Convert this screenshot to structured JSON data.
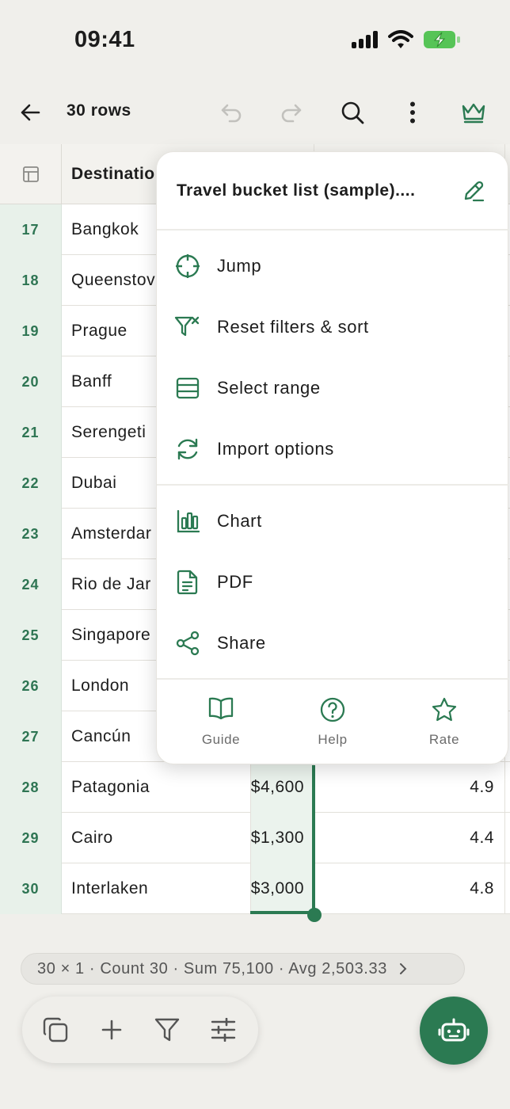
{
  "status_bar": {
    "time": "09:41"
  },
  "toolbar": {
    "title": "30 rows"
  },
  "grid": {
    "header_destination": "Destinatio",
    "rows": [
      {
        "n": "17",
        "destination": "Bangkok",
        "cost": "",
        "rating": ""
      },
      {
        "n": "18",
        "destination": "Queenstov",
        "cost": "",
        "rating": ""
      },
      {
        "n": "19",
        "destination": "Prague",
        "cost": "",
        "rating": ""
      },
      {
        "n": "20",
        "destination": "Banff",
        "cost": "",
        "rating": ""
      },
      {
        "n": "21",
        "destination": "Serengeti",
        "cost": "",
        "rating": ""
      },
      {
        "n": "22",
        "destination": "Dubai",
        "cost": "",
        "rating": ""
      },
      {
        "n": "23",
        "destination": "Amsterdar",
        "cost": "",
        "rating": ""
      },
      {
        "n": "24",
        "destination": "Rio de Jar",
        "cost": "",
        "rating": ""
      },
      {
        "n": "25",
        "destination": "Singapore",
        "cost": "",
        "rating": ""
      },
      {
        "n": "26",
        "destination": "London",
        "cost": "",
        "rating": ""
      },
      {
        "n": "27",
        "destination": "Cancún",
        "cost": "",
        "rating": ""
      },
      {
        "n": "28",
        "destination": "Patagonia",
        "cost": "$4,600",
        "rating": "4.9"
      },
      {
        "n": "29",
        "destination": "Cairo",
        "cost": "$1,300",
        "rating": "4.4"
      },
      {
        "n": "30",
        "destination": "Interlaken",
        "cost": "$3,000",
        "rating": "4.8"
      }
    ]
  },
  "menu": {
    "title": "Travel bucket list (sample)....",
    "items": [
      {
        "label": "Jump",
        "icon": "crosshair-icon"
      },
      {
        "label": "Reset filters & sort",
        "icon": "filter-reset-icon"
      },
      {
        "label": "Select range",
        "icon": "select-range-icon"
      },
      {
        "label": "Import options",
        "icon": "refresh-icon"
      },
      {
        "label": "Chart",
        "icon": "chart-icon"
      },
      {
        "label": "PDF",
        "icon": "document-icon"
      },
      {
        "label": "Share",
        "icon": "share-icon"
      }
    ],
    "footer": [
      {
        "label": "Guide",
        "icon": "book-icon"
      },
      {
        "label": "Help",
        "icon": "help-icon"
      },
      {
        "label": "Rate",
        "icon": "star-icon"
      }
    ]
  },
  "summary": {
    "text": "30 × 1 · Count 30 · Sum 75,100 · Avg 2,503.33"
  },
  "colors": {
    "accent": "#2b7a52",
    "row_number_bg": "#e8f1ea",
    "background": "#f0efeb"
  }
}
